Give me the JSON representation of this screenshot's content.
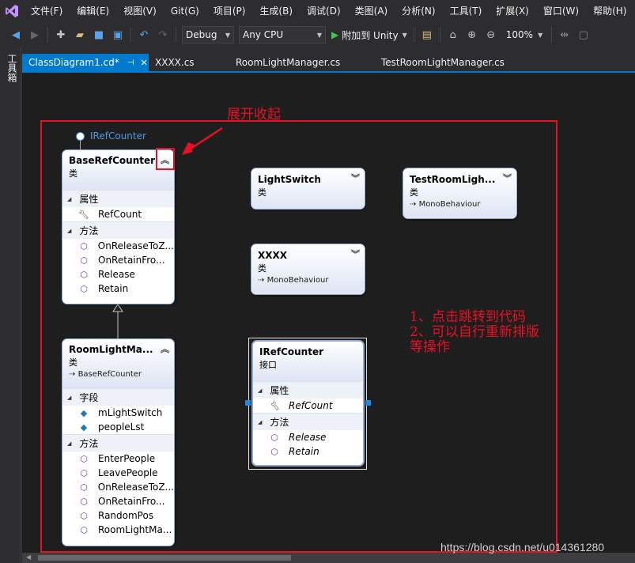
{
  "menu": [
    "文件(F)",
    "编辑(E)",
    "视图(V)",
    "Git(G)",
    "项目(P)",
    "生成(B)",
    "调试(D)",
    "类图(A)",
    "分析(N)",
    "工具(T)",
    "扩展(X)",
    "窗口(W)",
    "帮助(H)"
  ],
  "toolbar": {
    "config": "Debug",
    "platform": "Any CPU",
    "run_label": "附加到 Unity",
    "zoom": "100%"
  },
  "toolbox_label": "工具箱",
  "tabs": [
    {
      "label": "ClassDiagram1.cd*",
      "active": true
    },
    {
      "label": "XXXX.cs"
    },
    {
      "label": "RoomLightManager.cs"
    },
    {
      "label": "TestRoomLightManager.cs"
    }
  ],
  "annotations": {
    "title": "展开收起",
    "notes": [
      "1、点击跳转到代码",
      "2、可以自行重新排版",
      "等操作"
    ]
  },
  "lollipop_label": "IRefCounter",
  "shapes": {
    "base_ref_counter": {
      "name": "BaseRefCounter",
      "kind": "类",
      "sections": [
        {
          "title": "属性",
          "members": [
            {
              "name": "RefCount",
              "icon": "wrench-icon"
            }
          ]
        },
        {
          "title": "方法",
          "members": [
            {
              "name": "OnReleaseToZ...",
              "icon": "method-protected-icon"
            },
            {
              "name": "OnRetainFro...",
              "icon": "method-protected-icon"
            },
            {
              "name": "Release",
              "icon": "method-icon"
            },
            {
              "name": "Retain",
              "icon": "method-icon"
            }
          ]
        }
      ]
    },
    "room_light_manager": {
      "name": "RoomLightMa...",
      "kind": "类",
      "base": "BaseRefCounter",
      "sections": [
        {
          "title": "字段",
          "members": [
            {
              "name": "mLightSwitch",
              "icon": "field-private-icon"
            },
            {
              "name": "peopleLst",
              "icon": "field-private-icon"
            }
          ]
        },
        {
          "title": "方法",
          "members": [
            {
              "name": "EnterPeople",
              "icon": "method-icon"
            },
            {
              "name": "LeavePeople",
              "icon": "method-icon"
            },
            {
              "name": "OnReleaseToZ...",
              "icon": "method-protected-icon"
            },
            {
              "name": "OnRetainFro...",
              "icon": "method-protected-icon"
            },
            {
              "name": "RandomPos",
              "icon": "method-private-icon"
            },
            {
              "name": "RoomLightMa...",
              "icon": "method-icon"
            }
          ]
        }
      ]
    },
    "light_switch": {
      "name": "LightSwitch",
      "kind": "类"
    },
    "test_room": {
      "name": "TestRoomLigh...",
      "kind": "类",
      "base": "MonoBehaviour"
    },
    "xxxx": {
      "name": "XXXX",
      "kind": "类",
      "base": "MonoBehaviour"
    },
    "iref_counter": {
      "name": "IRefCounter",
      "kind": "接口",
      "sections": [
        {
          "title": "属性",
          "members": [
            {
              "name": "RefCount",
              "icon": "wrench-icon"
            }
          ]
        },
        {
          "title": "方法",
          "members": [
            {
              "name": "Release",
              "icon": "method-icon"
            },
            {
              "name": "Retain",
              "icon": "method-icon"
            }
          ]
        }
      ]
    }
  },
  "watermark": "https://blog.csdn.net/u014361280",
  "colors": {
    "accent": "#007acc",
    "annotation": "#e81123",
    "background": "#2d2d30",
    "canvas": "#1e1e1e"
  }
}
